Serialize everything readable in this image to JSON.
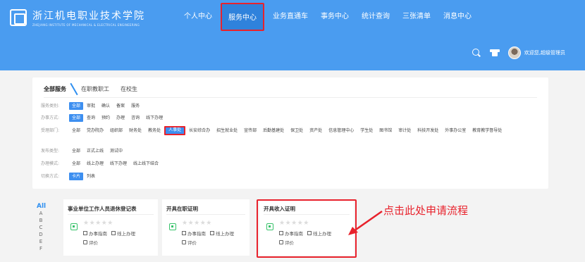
{
  "header": {
    "logo_cn": "浙江机电职业技术学院",
    "logo_en": "ZHEJIANG INSTITUTE OF MECHANICAL & ELECTRICAL ENGINEERING",
    "nav": [
      "个人中心",
      "服务中心",
      "业务直通车",
      "事务中心",
      "统计查询",
      "三张清单",
      "消息中心"
    ],
    "active_nav": "服务中心",
    "welcome": "欢迎您,超级管理员"
  },
  "tabs": [
    "全部服务",
    "在职教职工",
    "在校生"
  ],
  "filters": [
    {
      "label": "服务类别:",
      "options": [
        "全部",
        "审批",
        "确认",
        "备案",
        "服务"
      ],
      "selected": "全部"
    },
    {
      "label": "办事方式:",
      "options": [
        "全部",
        "查询",
        "预约",
        "办理",
        "咨询",
        "线下办理"
      ],
      "selected": "全部"
    },
    {
      "label": "受理部门:",
      "options": [
        "全部",
        "党办院办",
        "组织部",
        "财务处",
        "教务处",
        "人事处",
        "长安综合办",
        "招生就业处",
        "宣传部",
        "后勤基建处",
        "保卫处",
        "资产处",
        "信息管理中心",
        "学生处",
        "图书馆",
        "审计处",
        "科技开发处",
        "外事办公室",
        "教育教学督导处"
      ],
      "selected": "人事处"
    },
    {
      "label": "发布类型:",
      "options": [
        "全部",
        "正式上线",
        "测试中"
      ],
      "selected": ""
    },
    {
      "label": "办理模式:",
      "options": [
        "全部",
        "线上办理",
        "线下办理",
        "线上线下结合"
      ],
      "selected": ""
    },
    {
      "label": "切换方式:",
      "options": [
        "卡片",
        "列表"
      ],
      "selected": "卡片"
    }
  ],
  "alphabet": [
    "All",
    "A",
    "B",
    "C",
    "D",
    "E",
    "F"
  ],
  "cards": [
    {
      "title": "事业单位工作人员退休登记表",
      "stars": "★★★★★",
      "guide": "办事指南",
      "mode": "线上办理",
      "rate": "评价"
    },
    {
      "title": "开具在职证明",
      "stars": "★★★★★",
      "guide": "办事指南",
      "mode": "线上办理",
      "rate": "评价"
    },
    {
      "title": "开具收入证明",
      "stars": "★★★★★",
      "guide": "办事指南",
      "mode": "线上办理",
      "rate": "评价"
    }
  ],
  "annotation": "点击此处申请流程",
  "colors": {
    "header": "#4a9cf0",
    "accent": "#3d8ff0",
    "highlight": "#e8222c",
    "icon_green": "#37c26a"
  }
}
